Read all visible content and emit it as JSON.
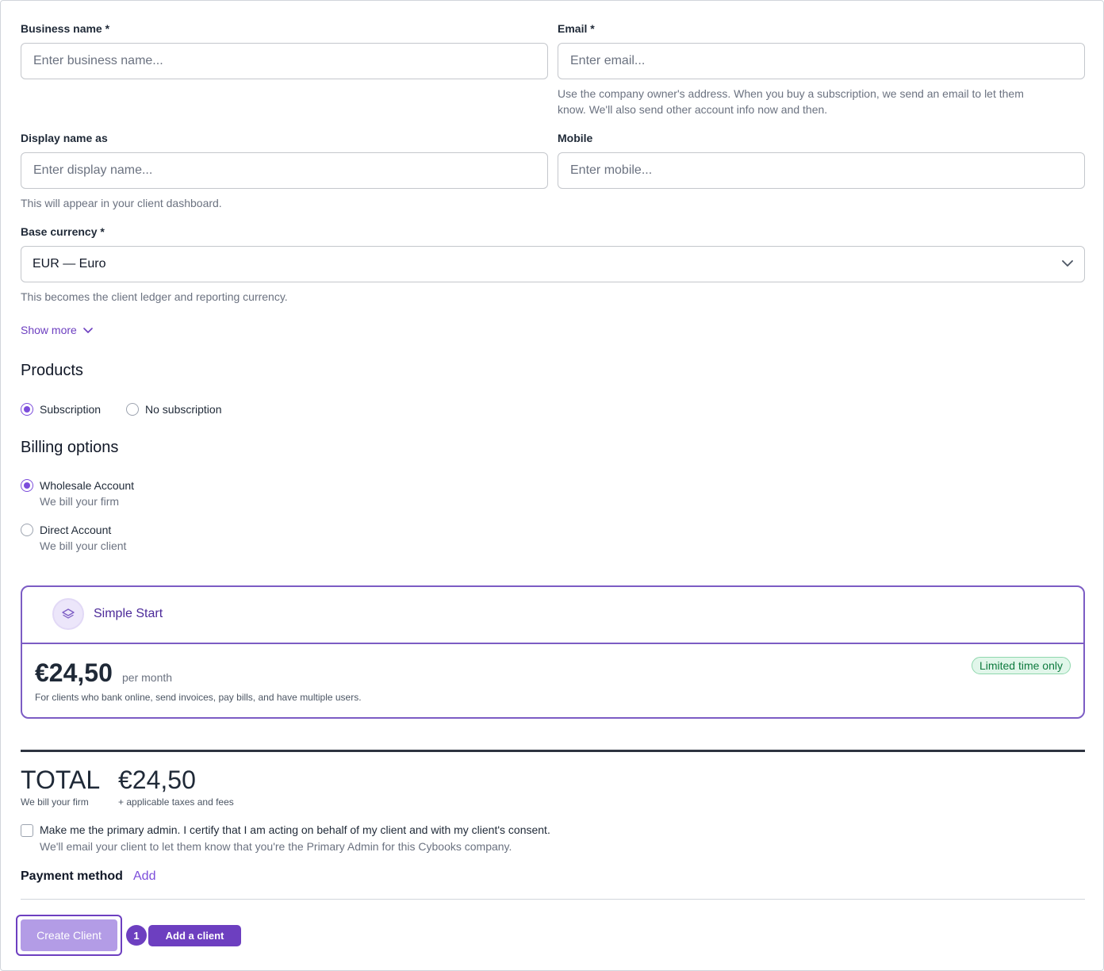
{
  "form": {
    "business_name": {
      "label": "Business name *",
      "placeholder": "Enter business name..."
    },
    "email": {
      "label": "Email *",
      "placeholder": "Enter email...",
      "help_line1": "Use the company owner's address. When you buy a subscription, we send an email to let them",
      "help_line2": "know. We'll also send other account info now and then."
    },
    "display_name": {
      "label": "Display name as",
      "placeholder": "Enter display name...",
      "help": "This will appear in your client dashboard."
    },
    "mobile": {
      "label": "Mobile",
      "placeholder": "Enter mobile..."
    },
    "currency": {
      "label": "Base currency *",
      "value": "EUR — Euro",
      "help": "This becomes the client ledger and reporting currency."
    },
    "show_more": "Show more"
  },
  "products": {
    "title": "Products",
    "options": [
      {
        "label": "Subscription",
        "selected": true
      },
      {
        "label": "No subscription",
        "selected": false
      }
    ]
  },
  "billing": {
    "title": "Billing options",
    "options": [
      {
        "label": "Wholesale Account",
        "sub": "We bill your firm",
        "selected": true
      },
      {
        "label": "Direct Account",
        "sub": "We bill your client",
        "selected": false
      }
    ]
  },
  "plan": {
    "name": "Simple Start",
    "price": "€24,50",
    "period": "per month",
    "description": "For clients who bank online, send invoices, pay bills, and have multiple users.",
    "badge": "Limited time only"
  },
  "total": {
    "label": "TOTAL",
    "sub": "We bill your firm",
    "amount": "€24,50",
    "note": "+ applicable taxes and fees"
  },
  "admin": {
    "text": "Make me the primary admin. I certify that I am acting on behalf of my client and with my client's consent.",
    "sub": "We'll email your client to let them know that you're the Primary Admin for this Cybooks company."
  },
  "payment": {
    "label": "Payment method",
    "action": "Add"
  },
  "footer": {
    "create_label": "Create Client",
    "step_number": "1",
    "tag_label": "Add a client"
  },
  "colors": {
    "accent": "#6d3fc0",
    "accent_light": "#b39ce6",
    "border": "#7c5cc4",
    "badge_bg": "#e1f6ea",
    "badge_text": "#0e7a3e"
  }
}
